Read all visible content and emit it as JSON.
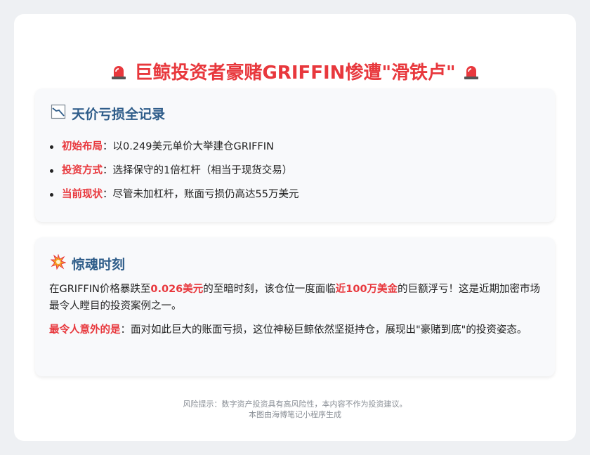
{
  "header": {
    "title": "巨鲸投资者豪赌GRIFFIN惨遭\"滑铁卢\"",
    "left_icon": "siren-icon",
    "right_icon": "siren-icon"
  },
  "record_section": {
    "icon": "chart-down-icon",
    "title": "天价亏损全记录",
    "items": [
      {
        "label": "初始布局",
        "sep": "：",
        "text": "以0.249美元单价大举建仓GRIFFIN"
      },
      {
        "label": "投资方式",
        "sep": "：",
        "text": "选择保守的1倍杠杆（相当于现货交易）"
      },
      {
        "label": "当前现状",
        "sep": "：",
        "text": "尽管未加杠杆，账面亏损仍高达55万美元"
      }
    ]
  },
  "moment_section": {
    "icon": "collision-icon",
    "title": "惊魂时刻",
    "para1": {
      "a": "在GRIFFIN价格暴跌至",
      "hl1": "0.026美元",
      "b": "的至暗时刻，该仓位一度面临",
      "hl2": "近100万美金",
      "c": "的巨额浮亏！这是近期加密市场最令人瞠目的投资案例之一。"
    },
    "para2": {
      "label": "最令人意外的是",
      "text": "：面对如此巨大的账面亏损，这位神秘巨鲸依然坚挺持仓，展现出\"豪赌到底\"的投资姿态。"
    }
  },
  "footer": {
    "risk": "风险提示：数字资产投资具有高风险性，本内容不作为投资建议。",
    "credit": "本图由海博笔记小程序生成"
  },
  "colors": {
    "accent": "#e8383d",
    "section_title": "#2f5d8a",
    "background": "#eef0f3"
  }
}
